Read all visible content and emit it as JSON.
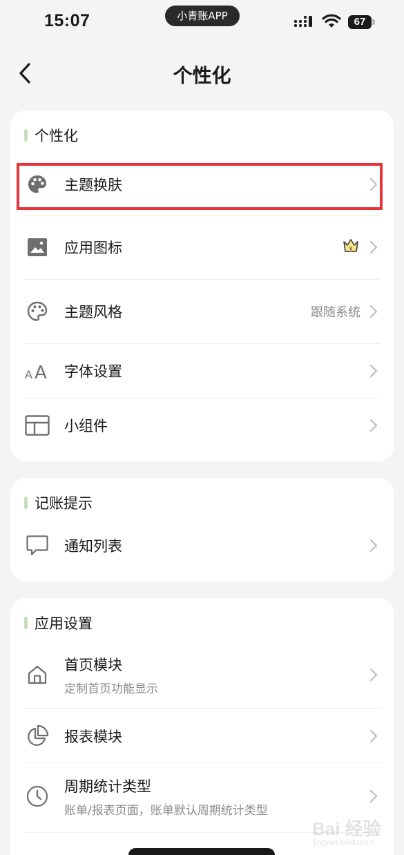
{
  "status_bar": {
    "time": "15:07",
    "app_name": "小青账APP",
    "battery": "67"
  },
  "nav": {
    "title": "个性化",
    "back_icon": "chevron-left-icon"
  },
  "sections": {
    "personalization": {
      "title": "个性化",
      "items": [
        {
          "label": "主题换肤",
          "icon": "palette-filled-icon"
        },
        {
          "label": "应用图标",
          "icon": "image-icon",
          "badge_icon": "vip-crown-icon"
        },
        {
          "label": "主题风格",
          "icon": "palette-outline-icon",
          "value": "跟随系统"
        },
        {
          "label": "字体设置",
          "icon": "font-size-icon"
        },
        {
          "label": "小组件",
          "icon": "widget-layout-icon"
        }
      ]
    },
    "reminders": {
      "title": "记账提示",
      "items": [
        {
          "label": "通知列表",
          "icon": "chat-bubble-icon"
        }
      ]
    },
    "app_settings": {
      "title": "应用设置",
      "items": [
        {
          "label": "首页模块",
          "sub": "定制首页功能显示",
          "icon": "home-icon"
        },
        {
          "label": "报表模块",
          "icon": "pie-chart-icon"
        },
        {
          "label": "周期统计类型",
          "sub": "账单/报表页面，账单默认周期统计类型",
          "icon": "clock-icon"
        }
      ]
    }
  },
  "colors": {
    "accent_bar": "#c6dfb8",
    "highlight_box": "#e8333a",
    "background": "#f4f4f4",
    "card": "#ffffff"
  },
  "watermark": {
    "main": "Bai 经验",
    "sub": "jingyan.baidu.com"
  }
}
